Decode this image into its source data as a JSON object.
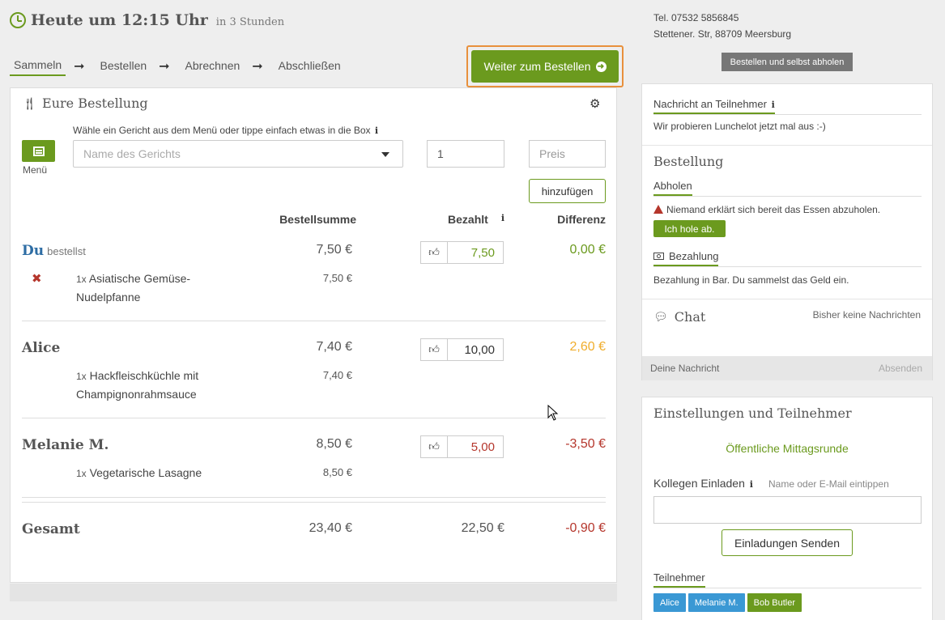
{
  "header": {
    "title": "Heute um 12:15 Uhr",
    "relative_time": "in 3 Stunden"
  },
  "steps": [
    "Sammeln",
    "Bestellen",
    "Abrechnen",
    "Abschließen"
  ],
  "continue_button": "Weiter zum Bestellen",
  "order": {
    "title": "Eure Bestellung",
    "hint": "Wähle ein Gericht aus dem Menü oder tippe einfach etwas in die Box",
    "menu_label": "Menü",
    "dish_placeholder": "Name des Gerichts",
    "quantity_value": "1",
    "price_placeholder": "Preis",
    "add_button": "hinzufügen",
    "columns": {
      "sum": "Bestellsumme",
      "paid": "Bezahlt",
      "diff": "Differenz"
    },
    "participants": [
      {
        "name": "Du",
        "note": "bestellst",
        "sum": "7,50 €",
        "paid": "7,50",
        "diff": "0,00 €",
        "diff_color": "#6b9a1e",
        "paid_color": "#6b9a1e",
        "items": [
          {
            "qty": "1x",
            "line1": "Asiatische Gemüse-",
            "line2": "Nudelpfanne",
            "price": "7,50 €"
          }
        ]
      },
      {
        "name": "Alice",
        "sum": "7,40 €",
        "paid": "10,00",
        "diff": "2,60 €",
        "diff_color": "#f0ad2c",
        "paid_color": "#333333",
        "items": [
          {
            "qty": "1x",
            "line1": "Hackfleischküchle mit",
            "line2": "Champignonrahmsauce",
            "price": "7,40 €"
          }
        ]
      },
      {
        "name": "Melanie M.",
        "sum": "8,50 €",
        "paid": "5,00",
        "diff": "-3,50 €",
        "diff_color": "#b5362c",
        "paid_color": "#b5362c",
        "items": [
          {
            "qty": "1x",
            "line1": "Vegetarische Lasagne",
            "line2": "",
            "price": "8,50 €"
          }
        ]
      }
    ],
    "total": {
      "label": "Gesamt",
      "sum": "23,40 €",
      "paid": "22,50 €",
      "diff": "-0,90 €"
    }
  },
  "contact": {
    "phone": "Tel. 07532 5856845",
    "address": "Stettener. Str, 88709 Meersburg"
  },
  "pickup_badge": "Bestellen und selbst abholen",
  "info": {
    "message_head": "Nachricht an Teilnehmer",
    "message_text": "Wir probieren Lunchelot jetzt mal aus :-)",
    "order_title": "Bestellung",
    "pickup_head": "Abholen",
    "pickup_warning": "Niemand erklärt sich bereit das Essen abzuholen.",
    "pickup_button": "Ich hole ab.",
    "payment_head": "Bezahlung",
    "payment_text": "Bezahlung in Bar. Du sammelst das Geld ein.",
    "chat_title": "Chat",
    "chat_empty": "Bisher keine Nachrichten",
    "chat_placeholder": "Deine Nachricht",
    "chat_send": "Absenden"
  },
  "settings": {
    "title": "Einstellungen und Teilnehmer",
    "visibility": "Öffentliche Mittagsrunde",
    "invite_label": "Kollegen Einladen",
    "invite_hint": "Name oder E-Mail eintippen",
    "invite_button": "Einladungen Senden",
    "participants_head": "Teilnehmer",
    "tags": [
      {
        "name": "Alice",
        "color": "#3a98d4"
      },
      {
        "name": "Melanie M.",
        "color": "#3a98d4"
      },
      {
        "name": "Bob Butler",
        "color": "#6b9a1e"
      }
    ]
  },
  "colors": {
    "accent": "#6b9a1e",
    "highlight": "#e8903c",
    "negative": "#b5362c",
    "positive_credit": "#f0ad2c",
    "self_name": "#2e6da4"
  }
}
